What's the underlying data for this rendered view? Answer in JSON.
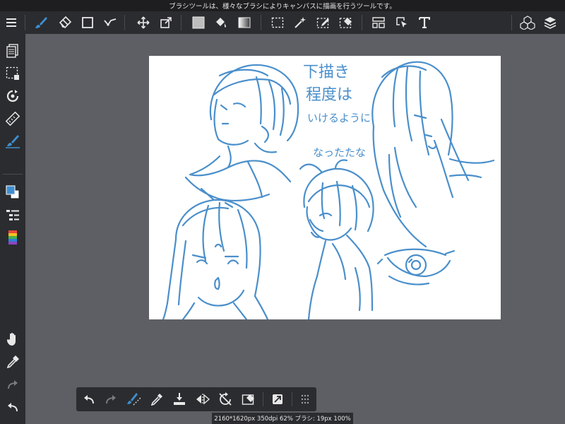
{
  "hint_text": "ブラシツールは、様々なブラシによりキャンバスに描画を行うツールです。",
  "status": {
    "text": "2160*1620px 350dpi 62% ブラシ: 19px 100%"
  },
  "canvas_text": {
    "line1": "下描き",
    "line2": "程度は",
    "line3": "いけるように",
    "line4": "なったたな"
  },
  "colors": {
    "accent": "#3e8fd1",
    "sketch": "#4a8fcb",
    "toolbar_bg": "#2b2c2f",
    "workspace_bg": "#5d5f64",
    "canvas_bg": "#ffffff"
  },
  "top_toolbar": [
    "menu-icon",
    "brush-icon",
    "eraser-icon",
    "shape-icon",
    "edit-icon",
    "move-icon",
    "transform-icon",
    "fill-color-icon",
    "bucket-icon",
    "gradient-icon",
    "select-rect-icon",
    "magic-wand-icon",
    "select-pen-icon",
    "select-eraser-icon",
    "panel-icon",
    "operation-icon",
    "text-icon",
    "3d-cube-icon",
    "layers-icon"
  ],
  "left_toolbar": [
    "pages-icon",
    "selection-icon",
    "navigator-icon",
    "ruler-icon",
    "brush-size-icon",
    "color-swatch-icon",
    "layer-list-icon",
    "color-palette-icon",
    "hand-icon",
    "eyedropper-icon",
    "redo-icon",
    "undo-icon"
  ],
  "bottom_toolbar": [
    "undo-icon",
    "redo-icon",
    "snap-icon",
    "eyedropper-icon",
    "import-icon",
    "flip-icon",
    "rotate-reset-icon",
    "clear-icon",
    "fit-icon",
    "more-icon"
  ]
}
